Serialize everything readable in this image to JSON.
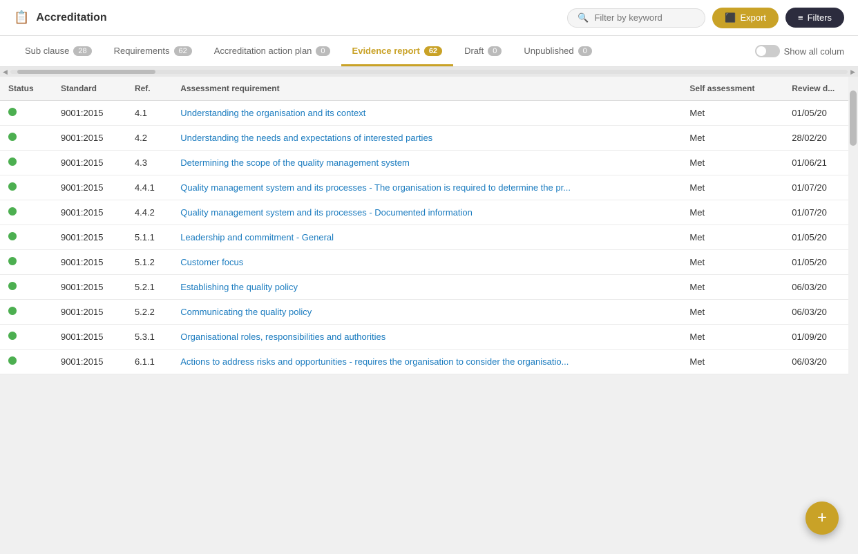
{
  "app": {
    "title": "Accreditation",
    "title_icon": "📋"
  },
  "header": {
    "search_placeholder": "Filter by keyword",
    "export_label": "Export",
    "filters_label": "Filters"
  },
  "tabs": [
    {
      "id": "sub-clause",
      "label": "Sub clause",
      "count": "28",
      "active": false
    },
    {
      "id": "requirements",
      "label": "Requirements",
      "count": "62",
      "active": false
    },
    {
      "id": "action-plan",
      "label": "Accreditation action plan",
      "count": "0",
      "active": false
    },
    {
      "id": "evidence-report",
      "label": "Evidence report",
      "count": "62",
      "active": true
    },
    {
      "id": "draft",
      "label": "Draft",
      "count": "0",
      "active": false
    },
    {
      "id": "unpublished",
      "label": "Unpublished",
      "count": "0",
      "active": false
    }
  ],
  "show_all_columns_label": "Show all colum",
  "table": {
    "columns": [
      {
        "id": "status",
        "label": "Status"
      },
      {
        "id": "standard",
        "label": "Standard"
      },
      {
        "id": "ref",
        "label": "Ref."
      },
      {
        "id": "assessment",
        "label": "Assessment requirement"
      },
      {
        "id": "self-assessment",
        "label": "Self assessment"
      },
      {
        "id": "review-date",
        "label": "Review d..."
      }
    ],
    "rows": [
      {
        "status": "green",
        "standard": "9001:2015",
        "ref": "4.1",
        "assessment": "Understanding the organisation and its context",
        "self_assessment": "Met",
        "review_date": "01/05/20"
      },
      {
        "status": "green",
        "standard": "9001:2015",
        "ref": "4.2",
        "assessment": "Understanding the needs and expectations of interested parties",
        "self_assessment": "Met",
        "review_date": "28/02/20"
      },
      {
        "status": "green",
        "standard": "9001:2015",
        "ref": "4.3",
        "assessment": "Determining the scope of the quality management system",
        "self_assessment": "Met",
        "review_date": "01/06/21"
      },
      {
        "status": "green",
        "standard": "9001:2015",
        "ref": "4.4.1",
        "assessment": "Quality management system and its processes - The organisation is required to determine the pr...",
        "self_assessment": "Met",
        "review_date": "01/07/20"
      },
      {
        "status": "green",
        "standard": "9001:2015",
        "ref": "4.4.2",
        "assessment": "Quality management system and its processes - Documented information",
        "self_assessment": "Met",
        "review_date": "01/07/20"
      },
      {
        "status": "green",
        "standard": "9001:2015",
        "ref": "5.1.1",
        "assessment": "Leadership and commitment - General",
        "self_assessment": "Met",
        "review_date": "01/05/20"
      },
      {
        "status": "green",
        "standard": "9001:2015",
        "ref": "5.1.2",
        "assessment": "Customer focus",
        "self_assessment": "Met",
        "review_date": "01/05/20"
      },
      {
        "status": "green",
        "standard": "9001:2015",
        "ref": "5.2.1",
        "assessment": "Establishing the quality policy",
        "self_assessment": "Met",
        "review_date": "06/03/20"
      },
      {
        "status": "green",
        "standard": "9001:2015",
        "ref": "5.2.2",
        "assessment": "Communicating the quality policy",
        "self_assessment": "Met",
        "review_date": "06/03/20"
      },
      {
        "status": "green",
        "standard": "9001:2015",
        "ref": "5.3.1",
        "assessment": "Organisational roles, responsibilities and authorities",
        "self_assessment": "Met",
        "review_date": "01/09/20"
      },
      {
        "status": "green",
        "standard": "9001:2015",
        "ref": "6.1.1",
        "assessment": "Actions to address risks and opportunities - requires the organisation to consider the organisatio...",
        "self_assessment": "Met",
        "review_date": "06/03/20"
      }
    ]
  },
  "fab_label": "+"
}
